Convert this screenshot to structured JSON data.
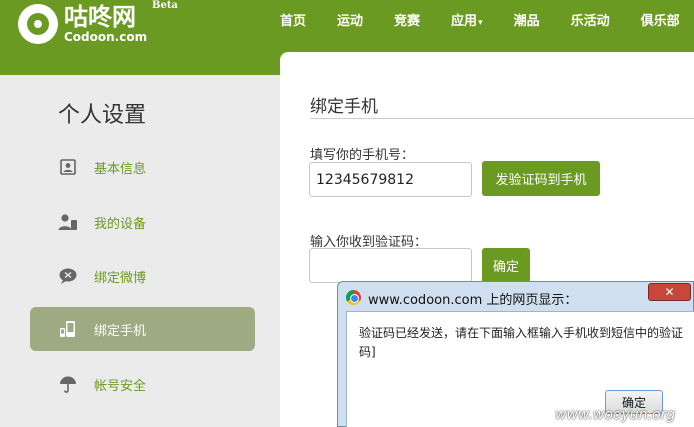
{
  "brand": {
    "name_cn": "咕咚网",
    "name_en": "Codoon.com",
    "badge": "Beta"
  },
  "nav": {
    "items": [
      {
        "label": "首页"
      },
      {
        "label": "运动"
      },
      {
        "label": "竞赛"
      },
      {
        "label": "应用"
      },
      {
        "label": "潮品"
      },
      {
        "label": "乐活动"
      },
      {
        "label": "俱乐部"
      }
    ],
    "dropdown_caret": "▾"
  },
  "sidebar": {
    "title": "个人设置",
    "items": [
      {
        "label": "基本信息",
        "icon": "profile-card-icon"
      },
      {
        "label": "我的设备",
        "icon": "user-device-icon"
      },
      {
        "label": "绑定微博",
        "icon": "speech-bubble-icon"
      },
      {
        "label": "绑定手机",
        "icon": "phone-icon",
        "active": true
      },
      {
        "label": "帐号安全",
        "icon": "umbrella-icon"
      }
    ]
  },
  "main": {
    "title": "绑定手机",
    "phone_label": "填写你的手机号：",
    "phone_value": "12345679812",
    "send_code_button": "发验证码到手机",
    "code_label": "输入你收到验证码：",
    "code_value": "",
    "confirm_button": "确定"
  },
  "dialog": {
    "title": "www.codoon.com 上的网页显示：",
    "close": "✕",
    "message": "验证码已经发送，请在下面输入框输入手机收到短信中的验证码]",
    "ok_button": "确定"
  },
  "watermark": "www.wooyun.org",
  "colors": {
    "brand_green": "#6b9a22",
    "active_item": "#9eaa82",
    "page_bg": "#ebebeb"
  }
}
